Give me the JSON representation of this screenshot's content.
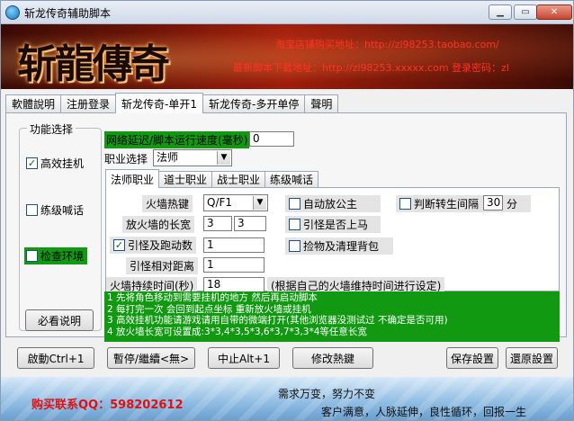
{
  "window": {
    "title": "斩龙传奇辅助脚本"
  },
  "banner": {
    "logo_text": "斩龍傳奇",
    "line1": "淘宝店铺购买地址：http://zl98253.taobao.com/",
    "line2": "最新脚本下载地址：http://zl98253.xxxxx.com 登录密码：zl"
  },
  "tabs": [
    "軟體說明",
    "注册登录",
    "斩龙传奇-单开1",
    "斩龙传奇-多开单停",
    "聲明"
  ],
  "func_group": {
    "title": "功能选择",
    "items": [
      {
        "label": "高效挂机",
        "checked": true
      },
      {
        "label": "练级喊话",
        "checked": false
      },
      {
        "label": "检查环境",
        "checked": false
      }
    ],
    "help_button": "必看说明"
  },
  "network_delay": {
    "label": "网络延迟/脚本运行速度(毫秒)",
    "value": "0"
  },
  "job": {
    "label": "职业选择",
    "value": "法师"
  },
  "subtabs": [
    "法师职业",
    "道士职业",
    "战士职业",
    "练级喊话"
  ],
  "mage": {
    "firewall_hotkey_label": "火墙热键",
    "firewall_hotkey_value": "Q/F1",
    "firewall_len_label": "放火墙的长宽",
    "firewall_len_w": "3",
    "firewall_len_h": "3",
    "lure_run_label": "引怪及跑动数",
    "lure_run_value": "1",
    "lure_dist_label": "引怪相对距离",
    "lure_dist_value": "1",
    "firewall_time_label": "火墙持续时间(秒)",
    "firewall_time_value": "18",
    "firewall_time_hint": "(根据自己的火墙维持时间进行设定)",
    "auto_shield": "自动放公主",
    "lure_mount": "引怪是否上马",
    "pickup_clean": "捡物及清理背包",
    "rebirth_interval": "判断转生间隔",
    "rebirth_value": "30",
    "rebirth_unit": "分"
  },
  "info_lines": [
    "1 先将角色移动到需要挂机的地方 然后再启动脚本",
    "2 每打完一次 会回到起点坐标 重新放火墙或挂机",
    "3 高效挂机功能请游戏请用自带的微端打开(其他浏览器没测试过 不确定是否可用)",
    "4 放火墙长宽可设置成:3*3,4*3,5*3,6*3,7*3,3*4等任意长宽"
  ],
  "buttons": {
    "start": "啟動Ctrl+1",
    "pause": "暫停/繼續<無>",
    "stop": "中止Alt+1",
    "modify": "修改熱鍵",
    "save": "保存設置",
    "restore": "還原設置"
  },
  "footer": {
    "qq": "购买联系QQ：598202612",
    "slogan": "需求万变，努力不变",
    "slogan2": "客户满意，人脉延伸，良性循环，回报一生"
  }
}
